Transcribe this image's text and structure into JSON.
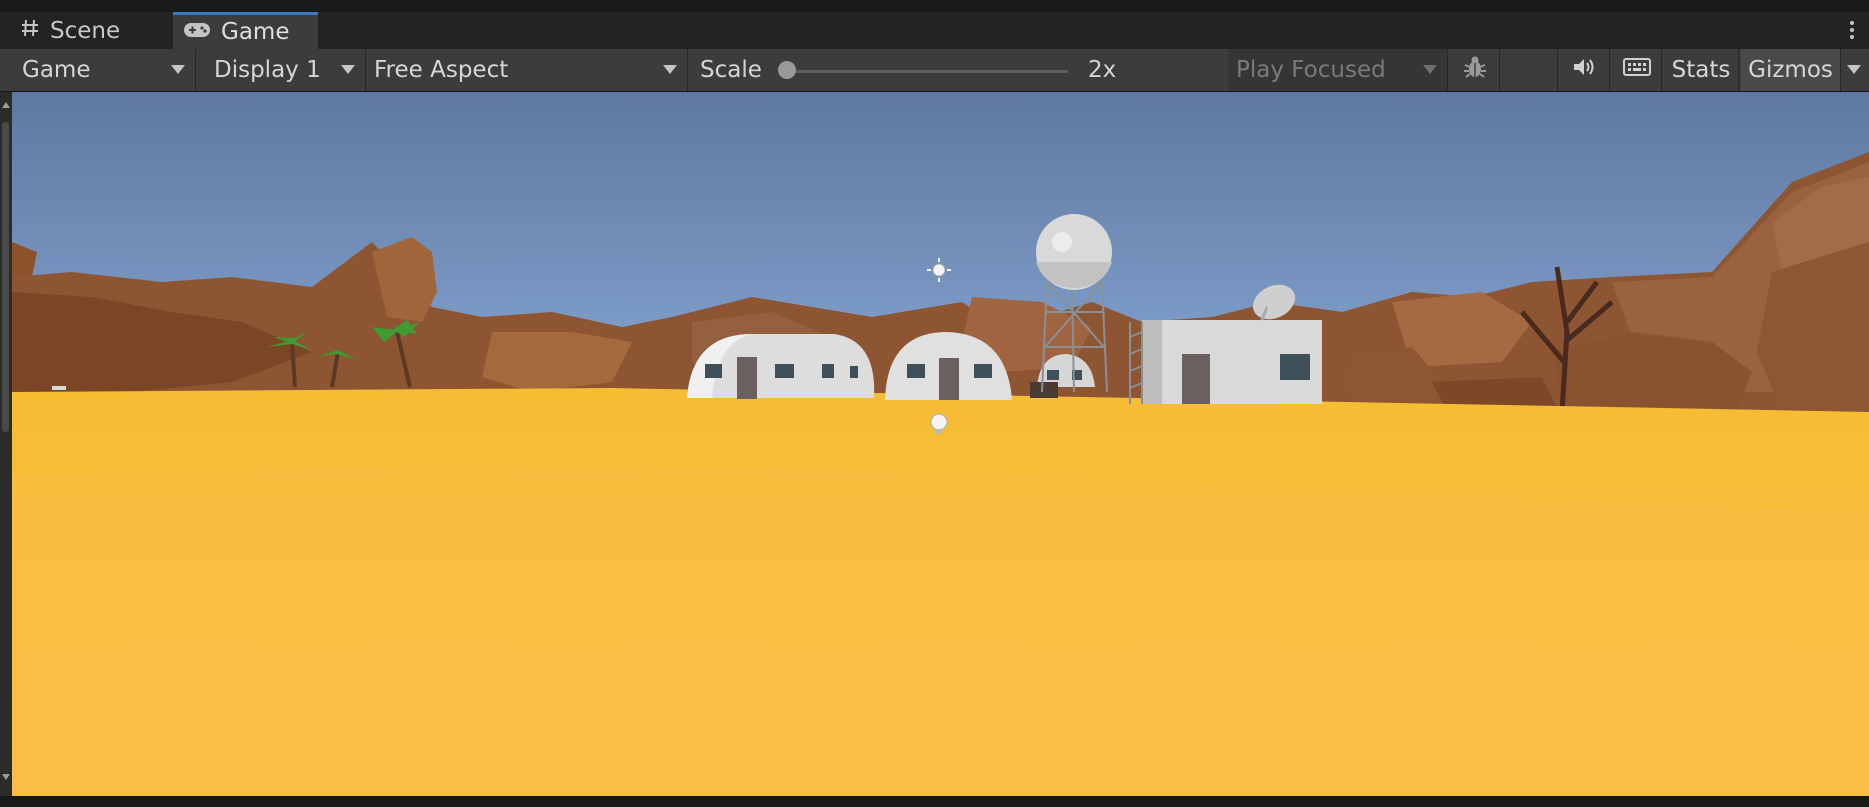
{
  "tabs": [
    {
      "label": "Scene",
      "icon": "grid-hash-icon"
    },
    {
      "label": "Game",
      "icon": "gamepad-icon",
      "active": true
    }
  ],
  "toolbar": {
    "view_dropdown": "Game",
    "display_dropdown": "Display 1",
    "aspect_dropdown": "Free Aspect",
    "scale_label": "Scale",
    "scale_value": "2x",
    "scale_level": 0.0,
    "play_mode_dropdown": "Play Focused",
    "bug_icon": "bug-icon",
    "audio_icon": "speaker-icon",
    "keyboard_icon": "keyboard-icon",
    "stats_label": "Stats",
    "gizmos_label": "Gizmos"
  },
  "colors": {
    "editor_bg": "#3c3c3c",
    "tab_accent": "#3a79bb",
    "sky_top": "#5f7aa0",
    "sky_bottom": "#98b8e0",
    "sand": "#fcbd3d",
    "rock": "#8e5530"
  }
}
